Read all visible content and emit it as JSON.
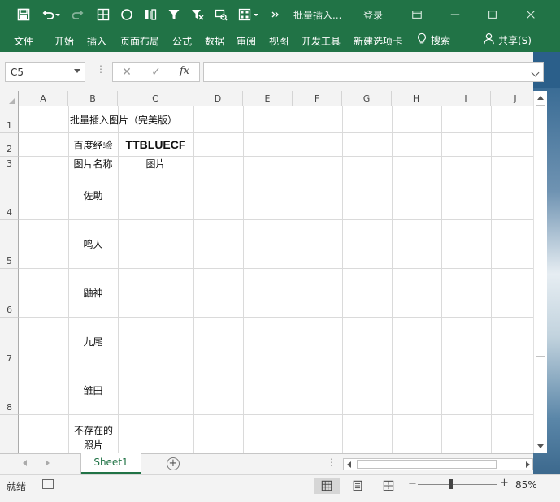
{
  "titlebar": {
    "title": "批量插入...",
    "login": "登录",
    "bg_color": "#217346"
  },
  "ribbon": {
    "tabs": [
      "文件",
      "开始",
      "插入",
      "页面布局",
      "公式",
      "数据",
      "审阅",
      "视图",
      "开发工具",
      "新建选项卡"
    ],
    "search": "搜索",
    "share": "共享(S)"
  },
  "formula_bar": {
    "name_box": "C5",
    "formula_value": ""
  },
  "grid": {
    "columns": [
      "A",
      "B",
      "C",
      "D",
      "E",
      "F",
      "G",
      "H",
      "I",
      "J"
    ],
    "rows": [
      "1",
      "2",
      "3",
      "4",
      "5",
      "6",
      "7",
      "8"
    ],
    "selected_column": "",
    "cells": {
      "B1": "批量插入图片（完美版）",
      "B2": "百度经验",
      "C2": "TTBLUECF",
      "B3": "图片名称",
      "C3": "图片",
      "B4": "佐助",
      "B5": "鸣人",
      "B6": "鼬神",
      "B7": "九尾",
      "B8": "雏田",
      "B9": "不存在的照片"
    }
  },
  "sheets": {
    "active": "Sheet1"
  },
  "status": {
    "ready": "就绪",
    "zoom": "85%",
    "zoom_fraction": 0.42
  },
  "colors": {
    "accent": "#217346",
    "grid_line": "#dadada",
    "header_bg": "#f3f3f3"
  }
}
